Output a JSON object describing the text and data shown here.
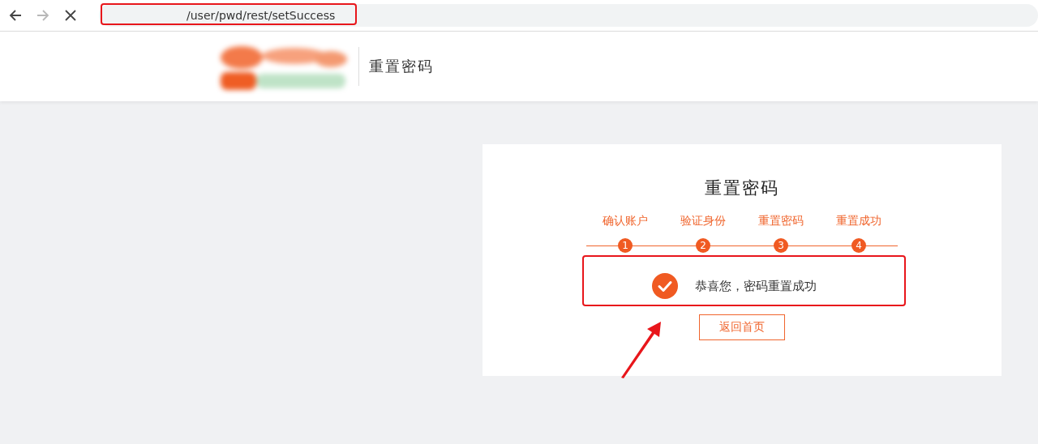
{
  "browser": {
    "url": "/user/pwd/rest/setSuccess",
    "back_disabled": false,
    "forward_disabled": true
  },
  "header": {
    "title": "重置密码"
  },
  "card": {
    "title": "重置密码",
    "steps": [
      {
        "label": "确认账户",
        "number": "1",
        "done": true
      },
      {
        "label": "验证身份",
        "number": "2",
        "done": true
      },
      {
        "label": "重置密码",
        "number": "3",
        "done": true
      },
      {
        "label": "重置成功",
        "number": "4",
        "done": true
      }
    ],
    "message": "恭喜您，密码重置成功",
    "button": "返回首页"
  }
}
